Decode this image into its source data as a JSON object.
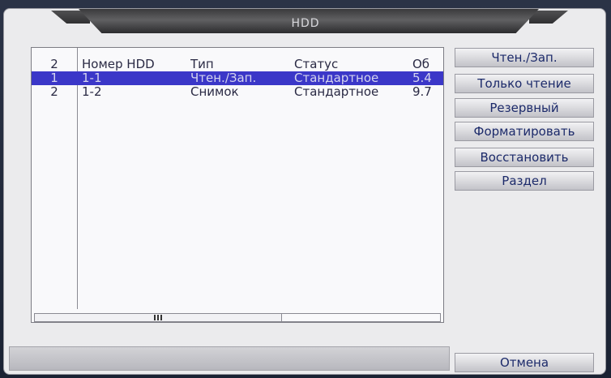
{
  "dialog": {
    "title": "HDD"
  },
  "table": {
    "header": {
      "index": "2",
      "hdd_number": "Номер HDD",
      "type": "Тип",
      "status": "Статус",
      "size": "Об"
    },
    "rows": [
      {
        "index": "1",
        "hdd_number": "1-1",
        "type": "Чтен./Зап.",
        "status": "Стандартное",
        "size": "5.4",
        "selected": true
      },
      {
        "index": "2",
        "hdd_number": "1-2",
        "type": "Снимок",
        "status": "Стандартное",
        "size": "9.7",
        "selected": false
      }
    ]
  },
  "actions": {
    "read_write": "Чтен./Зап.",
    "read_only": "Только чтение",
    "redundant": "Резервный",
    "format": "Форматировать",
    "recover": "Восстановить",
    "partition": "Раздел"
  },
  "footer": {
    "cancel": "Отмена"
  },
  "colors": {
    "selection": "#3b37c8",
    "button_text": "#1c2a6a",
    "dialog_bg": "#ebebed"
  }
}
